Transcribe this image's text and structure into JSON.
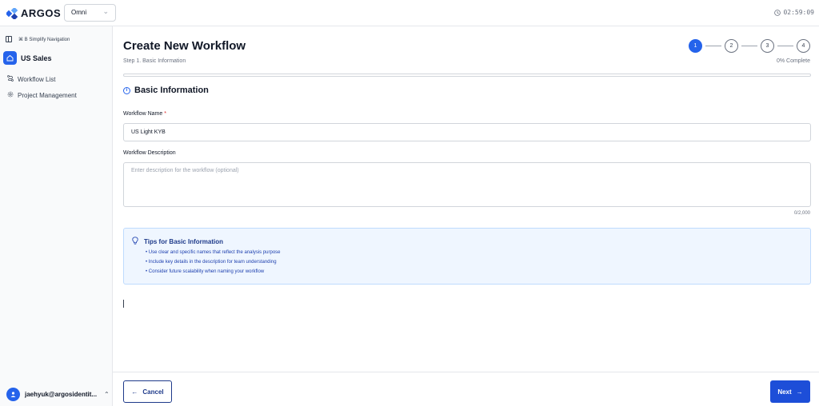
{
  "header": {
    "logo_text": "ARGOS",
    "org_select": {
      "value": "Omni"
    },
    "clock": "02:59:09"
  },
  "sidebar": {
    "simplify_label": "⌘ B Simplify Navigation",
    "workspace": "US Sales",
    "items": [
      {
        "label": "Workflow List",
        "icon": "route-icon"
      },
      {
        "label": "Project Management",
        "icon": "gear-icon"
      }
    ],
    "user": {
      "name": "jaehyuk@argosidentit...",
      "avatar_icon": "person-icon"
    }
  },
  "page": {
    "title": "Create New Workflow",
    "step_subtitle": "Step 1. Basic Information",
    "steps": [
      "1",
      "2",
      "3",
      "4"
    ],
    "active_step": 1,
    "complete_label": "0% Complete",
    "progress_fraction": 0
  },
  "form": {
    "section_title": "Basic Information",
    "name_label": "Workflow Name",
    "required_mark": "*",
    "name_value": "US Light KYB",
    "description_label": "Workflow Description",
    "description_placeholder": "Enter description for the workflow (optional)",
    "counter": "0/2,000"
  },
  "tips": {
    "title": "Tips for Basic Information",
    "items": [
      "• Use clear and specific names that reflect the analysis purpose",
      "• Include key details in the description for team understanding",
      "• Consider future scalability when naming your workflow"
    ]
  },
  "footer": {
    "cancel_label": "Cancel",
    "next_label": "Next"
  },
  "colors": {
    "accent": "#2563eb",
    "tips_bg": "#eff6ff"
  }
}
